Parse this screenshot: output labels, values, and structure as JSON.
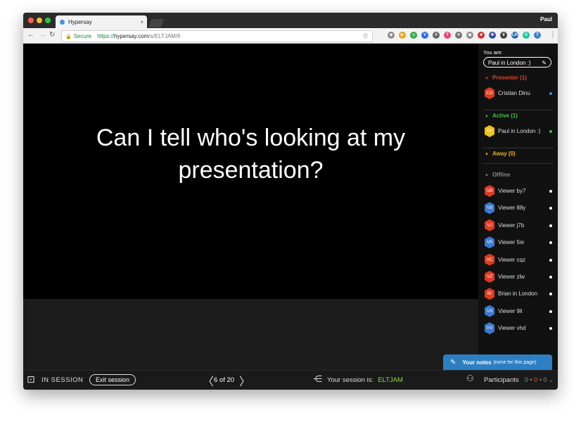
{
  "browser": {
    "tab_title": "Hypersay",
    "tab_close": "×",
    "profile_name": "Paul",
    "back": "←",
    "forward": "→",
    "reload": "↻",
    "lock": "🔒",
    "secure_label": "Secure",
    "url_scheme": "https://",
    "url_host": "hypersay.com",
    "url_path": "/s/ELTJAM/6",
    "star": "☆",
    "extensions": [
      {
        "name": "ext-gray",
        "color": "#8a8a8a",
        "glyph": "◉"
      },
      {
        "name": "ext-orange",
        "color": "#f0a020",
        "glyph": "▶"
      },
      {
        "name": "ext-green",
        "color": "#2aa84a",
        "glyph": "◎"
      },
      {
        "name": "ext-vivaldi",
        "color": "#2d6cdf",
        "glyph": "V"
      },
      {
        "name": "ext-hash",
        "color": "#666666",
        "glyph": "#"
      },
      {
        "name": "ext-pink",
        "color": "#e0457b",
        "glyph": "T"
      },
      {
        "name": "ext-pocket",
        "color": "#777777",
        "glyph": "♥"
      },
      {
        "name": "ext-gray2",
        "color": "#888888",
        "glyph": "▣"
      },
      {
        "name": "ext-red",
        "color": "#d43030",
        "glyph": "■"
      },
      {
        "name": "ext-star",
        "color": "#2d4fa0",
        "glyph": "✱"
      },
      {
        "name": "ext-bug",
        "color": "#444444",
        "glyph": "¥"
      },
      {
        "name": "ext-lh",
        "color": "#2b6cb0",
        "glyph": "LH"
      },
      {
        "name": "ext-grammarly",
        "color": "#15c39a",
        "glyph": "G"
      },
      {
        "name": "ext-t",
        "color": "#3b82c4",
        "glyph": "T"
      }
    ],
    "menu": "⋮"
  },
  "slide": {
    "text": "Can I tell who's looking at my presentation?"
  },
  "sidebar": {
    "you_are_label": "You are:",
    "your_name": "Paul in London :)",
    "pencil": "✎",
    "sections": {
      "presenter": {
        "label": "Presenter (1)",
        "color": "#e0402a",
        "caret": "▼"
      },
      "active": {
        "label": "Active (1)",
        "color": "#3cc04a",
        "caret": "▼"
      },
      "away": {
        "label": "Away (0)",
        "color": "#f0b020",
        "caret": "▼"
      },
      "offline": {
        "label": "Offline",
        "color": "#888888",
        "caret": "▼"
      }
    },
    "presenters": [
      {
        "initials": "CD",
        "name": "Cristian Dinu",
        "avatar_color": "#e03a1e",
        "status_color": "#3a8fe0"
      }
    ],
    "active": [
      {
        "initials": "PI",
        "name": "Paul in London :)",
        "avatar_color": "#f0c020",
        "status_color": "#3cc04a"
      }
    ],
    "offline": [
      {
        "initials": "VB",
        "name": "Viewer by7",
        "avatar_color": "#e03a1e",
        "status_color": "#ffffff"
      },
      {
        "initials": "V8",
        "name": "Viewer 88y",
        "avatar_color": "#3a7ad0",
        "status_color": "#ffffff"
      },
      {
        "initials": "VJ",
        "name": "Viewer j7b",
        "avatar_color": "#e03a1e",
        "status_color": "#ffffff"
      },
      {
        "initials": "V5",
        "name": "Viewer 5ie",
        "avatar_color": "#3a7ad0",
        "status_color": "#ffffff"
      },
      {
        "initials": "VC",
        "name": "Viewer cqz",
        "avatar_color": "#e03a1e",
        "status_color": "#ffffff"
      },
      {
        "initials": "VZ",
        "name": "Viewer zlw",
        "avatar_color": "#e03a1e",
        "status_color": "#ffffff"
      },
      {
        "initials": "BI",
        "name": "Brian in London",
        "avatar_color": "#e03a1e",
        "status_color": "#ffffff"
      },
      {
        "initials": "V9",
        "name": "Viewer 9li",
        "avatar_color": "#3a7ad0",
        "status_color": "#ffffff"
      },
      {
        "initials": "VV",
        "name": "Viewer vhd",
        "avatar_color": "#3a7ad0",
        "status_color": "#ffffff"
      }
    ]
  },
  "notes": {
    "icon": "✎",
    "label": "Your notes",
    "sub": "(none for this page)"
  },
  "bottom": {
    "session_icon": "⊡",
    "in_session": "IN SESSION",
    "exit_label": "Exit session",
    "prev": "〈",
    "next": "〉",
    "page": "6 of 20",
    "share_icon": "⋲",
    "session_label": "Your session is:",
    "session_code": "ELTJAM",
    "people_icon": "⚇",
    "participants_label": "Participants",
    "count_active": "0",
    "count_away": "0",
    "count_offline": "0",
    "caret": "⌄",
    "count_colors": {
      "active": "#3cc04a",
      "away": "#e05a20",
      "offline": "#888888"
    }
  }
}
